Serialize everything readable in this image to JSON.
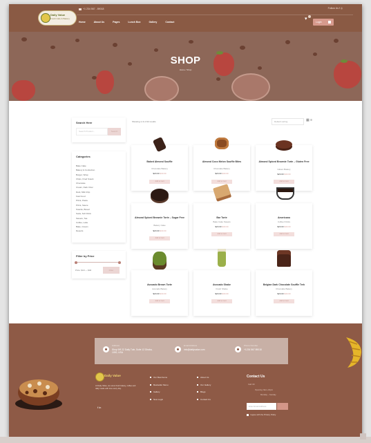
{
  "header": {
    "logo_text": "Daily Value",
    "logo_sub": "Fresh Cafe & Bakery",
    "contact": "+1 234 567 - 89018",
    "social": "Follow Us",
    "nav": [
      "Home",
      "About Us",
      "Pages",
      "Lunch Box",
      "Gallery",
      "Contact"
    ],
    "login_label": "Login"
  },
  "hero": {
    "title": "SHOP",
    "breadcrumb": "Home  /  Shop"
  },
  "sidebar": {
    "search_title": "Search Here",
    "search_placeholder": "Search Product...",
    "search_button": "Search",
    "categories_title": "Categories",
    "categories": [
      "Bake Cake",
      "Bakery & Confection",
      "Burger, Wrap",
      "Chips, Fried Snack",
      "Chocolate",
      "Cream, Dark Choc",
      "Dark, Milk Chip",
      "Fast Food",
      "Pizza, Pasta",
      "Pizza, Sauce",
      "Snacks, Bread",
      "Soda, Soft Drink",
      "Sweets, Tea",
      "Coffee, Latte",
      "Bake, Cream",
      "Deserts"
    ],
    "filter_title": "Filter by Price",
    "price_label": "Price: $10 — $40",
    "filter_button": "Filter"
  },
  "shop": {
    "results": "Showing 1–9 of 22 results",
    "sort": "Default sorting",
    "products": [
      {
        "name": "Baked Almond Souffle",
        "category": "Chocolate Bakery",
        "price": "$20.00",
        "old": "$30.00",
        "button": "Add to Cart"
      },
      {
        "name": "Almond Coco Melon Souffle Bites",
        "category": "Chocolate Bakery",
        "price": "$20.00",
        "old": "$30.00",
        "button": "Add to Cart"
      },
      {
        "name": "Almond Spiced Brownie Torte – Gluten Free",
        "category": "Gluten Bakery",
        "price": "$20.00",
        "old": "$30.00",
        "button": "Add to Cart"
      },
      {
        "name": "Almond Spiced Brownie Torte – Sugar Free",
        "category": "Bakery Cake",
        "price": "$20.00",
        "old": "$30.00",
        "button": "Add to Cart"
      },
      {
        "name": "Bar Torte",
        "category": "Bake Cake Sweets",
        "price": "$20.00",
        "old": "$30.00",
        "button": "Add to Cart"
      },
      {
        "name": "Americano",
        "category": "Coffee Drinks",
        "price": "$20.00",
        "old": "$30.00",
        "button": "Add to Cart"
      },
      {
        "name": "Avocado Brown Torte",
        "category": "Avocado Bakery",
        "price": "$20.00",
        "old": "$30.00",
        "button": "Add to Cart"
      },
      {
        "name": "Avocado Shake",
        "category": "Fresh Shake",
        "price": "$20.00",
        "old": "$30.00",
        "button": "Add to Cart"
      },
      {
        "name": "Belgian Dark Chocolate Souffle Trek",
        "category": "Chocolate Bakery",
        "price": "$20.00",
        "old": "$30.00",
        "button": "Add to Cart"
      }
    ]
  },
  "footer": {
    "address_label": "Address",
    "address": "Shop 9/9 22 Daily Tule, Suite 12 Dhaka, 1000, USA",
    "email_label": "Email Address",
    "email": "info@dailyvalue.com",
    "phone_label": "Phone Number",
    "phone": "+1234 567 89018",
    "logo_text": "Daily Value",
    "about": "At Daily Value, we serve fresh bakery, coffee and daily meals with love every day.",
    "social": "f   in",
    "links_col1": [
      "Our Best Items",
      "Bestseller Menu",
      "Gallery",
      "New Login"
    ],
    "links_col2": [
      "About Us",
      "Our Gallery",
      "Blogs",
      "Contact Us"
    ],
    "contact_title": "Contact Us",
    "contact_line1": "Call: 00",
    "contact_line2": "Opening: 9am–10pm",
    "contact_line3": "Monday – Sunday",
    "email_placeholder": "Enter Email Address",
    "checkbox_label": "I agree with the Privacy Policy"
  },
  "colors": {
    "brand_brown": "#8e5a46",
    "accent_pink": "#d79a8d",
    "card_bg": "#ffffff"
  }
}
